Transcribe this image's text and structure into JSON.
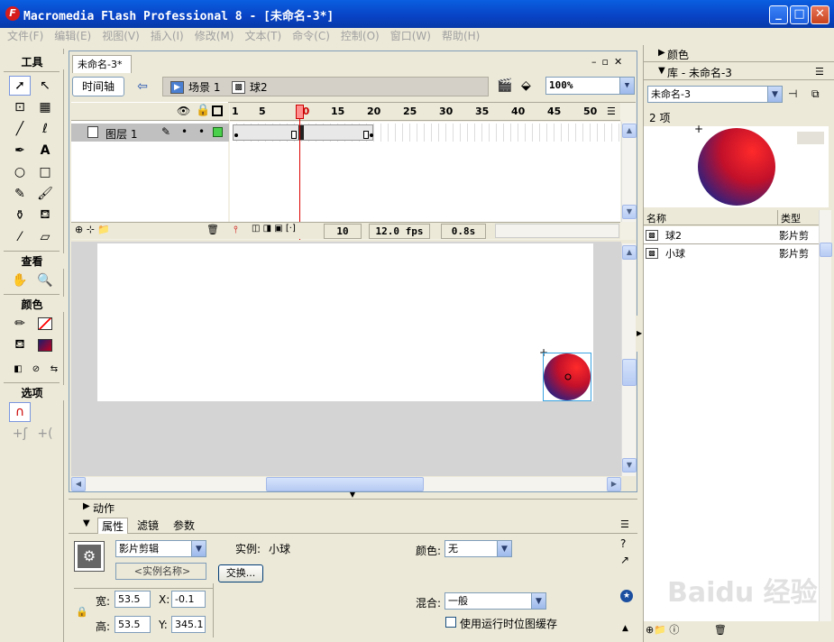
{
  "window": {
    "title": "Macromedia Flash Professional 8 - [未命名-3*]",
    "app_icon": "F"
  },
  "menu": [
    "文件(F)",
    "编辑(E)",
    "视图(V)",
    "插入(I)",
    "修改(M)",
    "文本(T)",
    "命令(C)",
    "控制(O)",
    "窗口(W)",
    "帮助(H)"
  ],
  "tools": {
    "header": "工具",
    "view_header": "查看",
    "color_header": "颜色",
    "options_header": "选项"
  },
  "doc": {
    "tab": "未命名-3*",
    "timeline_btn": "时间轴",
    "scene": "场景 1",
    "symbol": "球2",
    "zoom": "100%"
  },
  "timeline": {
    "frame_numbers": [
      "1",
      "5",
      "10",
      "15",
      "20",
      "25",
      "30",
      "35",
      "40",
      "45",
      "50"
    ],
    "layer_name": "图层 1",
    "current_frame": "10",
    "fps": "12.0 fps",
    "time": "0.8s"
  },
  "panels": {
    "actions": "动作",
    "props_tabs": [
      "属性",
      "滤镜",
      "参数"
    ],
    "symbol_type": "影片剪辑",
    "instance_label": "实例:",
    "instance_value": "小球",
    "instance_name_placeholder": "<实例名称>",
    "swap_btn": "交换...",
    "color_label": "颜色:",
    "color_value": "无",
    "width_label": "宽:",
    "width": "53.5",
    "height_label": "高:",
    "height": "53.5",
    "x_label": "X:",
    "x": "-0.1",
    "y_label": "Y:",
    "y": "345.1",
    "blend_label": "混合:",
    "blend_value": "一般",
    "cache_label": "使用运行时位图缓存"
  },
  "right": {
    "color_panel": "颜色",
    "library_panel": "库 - 未命名-3",
    "library_select": "未命名-3",
    "item_count": "2 项",
    "col_name": "名称",
    "col_type": "类型",
    "items": [
      {
        "name": "球2",
        "type": "影片剪"
      },
      {
        "name": "小球",
        "type": "影片剪"
      }
    ]
  },
  "watermark": "Baidu 经验"
}
